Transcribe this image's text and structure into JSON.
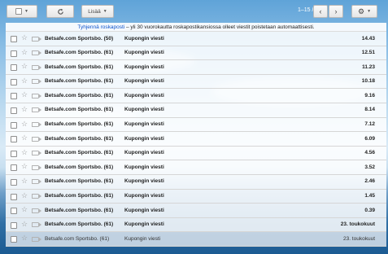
{
  "toolbar": {
    "more_label": "Lisää",
    "counter": "1–15 / 15"
  },
  "notice": {
    "link": "Tyhjennä roskaposti",
    "text": " – yli 30 vuorokautta roskapostikansiossa olleet viestit poistetaan automaattisesti."
  },
  "rows": [
    {
      "sender": "Betsafe.com Sportsbo. (50)",
      "subject": "Kupongin viesti",
      "date": "14.43"
    },
    {
      "sender": "Betsafe.com Sportsbo. (61)",
      "subject": "Kupongin viesti",
      "date": "12.51"
    },
    {
      "sender": "Betsafe.com Sportsbo. (61)",
      "subject": "Kupongin viesti",
      "date": "11.23"
    },
    {
      "sender": "Betsafe.com Sportsbo. (61)",
      "subject": "Kupongin viesti",
      "date": "10.18"
    },
    {
      "sender": "Betsafe.com Sportsbo. (61)",
      "subject": "Kupongin viesti",
      "date": "9.16"
    },
    {
      "sender": "Betsafe.com Sportsbo. (61)",
      "subject": "Kupongin viesti",
      "date": "8.14"
    },
    {
      "sender": "Betsafe.com Sportsbo. (61)",
      "subject": "Kupongin viesti",
      "date": "7.12"
    },
    {
      "sender": "Betsafe.com Sportsbo. (61)",
      "subject": "Kupongin viesti",
      "date": "6.09"
    },
    {
      "sender": "Betsafe.com Sportsbo. (61)",
      "subject": "Kupongin viesti",
      "date": "4.56"
    },
    {
      "sender": "Betsafe.com Sportsbo. (61)",
      "subject": "Kupongin viesti",
      "date": "3.52"
    },
    {
      "sender": "Betsafe.com Sportsbo. (61)",
      "subject": "Kupongin viesti",
      "date": "2.46"
    },
    {
      "sender": "Betsafe.com Sportsbo. (61)",
      "subject": "Kupongin viesti",
      "date": "1.45"
    },
    {
      "sender": "Betsafe.com Sportsbo. (61)",
      "subject": "Kupongin viesti",
      "date": "0.39"
    },
    {
      "sender": "Betsafe.com Sportsbo. (61)",
      "subject": "Kupongin viesti",
      "date": "23. toukokuut"
    },
    {
      "sender": "Betsafe.com Sportsbo. (61)",
      "subject": "Kupongin viesti",
      "date": "23. toukokuut"
    }
  ],
  "icons": {
    "select": "checkbox-dropdown-icon",
    "refresh": "refresh-icon",
    "prev": "chevron-left-icon",
    "next": "chevron-right-icon",
    "settings": "gear-icon",
    "star": "star-icon",
    "important": "important-marker-icon"
  },
  "colors": {
    "link": "#1155cc",
    "row_bg": "#ffffff"
  }
}
